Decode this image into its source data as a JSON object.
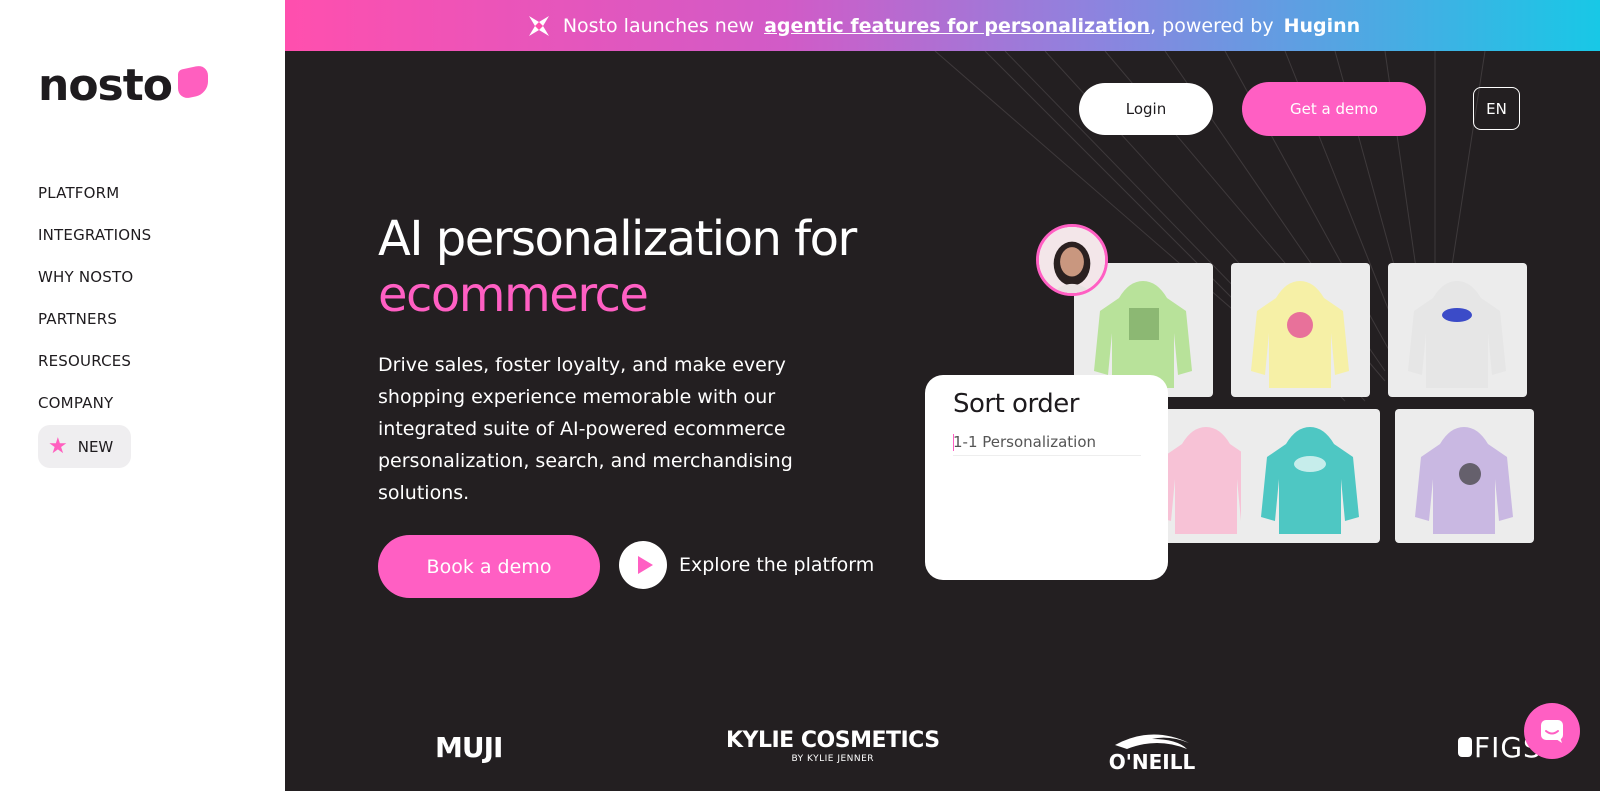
{
  "sidebar": {
    "logo": "nosto",
    "nav": [
      {
        "label": "PLATFORM"
      },
      {
        "label": "INTEGRATIONS"
      },
      {
        "label": "WHY NOSTO"
      },
      {
        "label": "PARTNERS"
      },
      {
        "label": "RESOURCES"
      },
      {
        "label": "COMPANY"
      }
    ],
    "new_label": "NEW"
  },
  "banner": {
    "prefix": "Nosto launches new",
    "link_text": "agentic features for personalization",
    "middle": ", powered by",
    "brand": "Huginn"
  },
  "header": {
    "login_label": "Login",
    "demo_label": "Get a demo",
    "lang_label": "EN"
  },
  "hero": {
    "title_line1": "AI personalization for",
    "title_accent": "ecommerce",
    "subtitle": "Drive sales, foster loyalty, and make every shopping experience memorable with our integrated suite of AI-powered ecommerce personalization, search, and merchandising solutions.",
    "book_label": "Book a demo",
    "explore_label": "Explore the platform"
  },
  "sort_card": {
    "title": "Sort order",
    "item": "1-1 Personalization"
  },
  "products": [
    {
      "color": "#b8e29a",
      "print": "#6e9c5a",
      "name": "green-hoodie"
    },
    {
      "color": "#f6f0a6",
      "print": "#e8719a",
      "name": "yellow-hoodie"
    },
    {
      "color": "#e6e6e6",
      "print": "#3b4bc8",
      "name": "grey-hoodie"
    },
    {
      "color": "#f7c2d6",
      "print": "#e8a3bf",
      "name": "pink-hoodie"
    },
    {
      "color": "#4ec7c3",
      "print": "#e5f6f5",
      "name": "teal-hoodie"
    },
    {
      "color": "#c9b8e2",
      "print": "#3a3a3a",
      "name": "lavender-hoodie"
    }
  ],
  "brands": {
    "muji": "MUJI",
    "kylie": "KYLIE COSMETICS",
    "kylie_sub": "BY KYLIE JENNER",
    "oneill": "O'NEILL",
    "figs": "FIGS"
  },
  "colors": {
    "accent": "#ff5fc3",
    "hero_bg": "#231f21"
  }
}
